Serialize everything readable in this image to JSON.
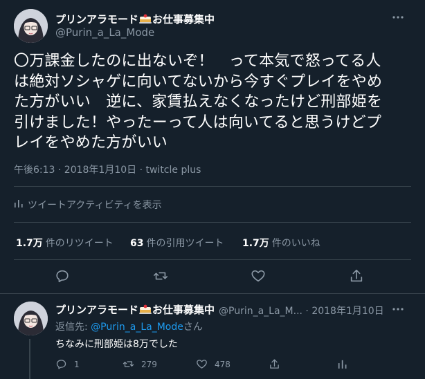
{
  "main_tweet": {
    "display_name": "プリンアラモード",
    "display_name_suffix": "お仕事募集中",
    "handle": "@Purin_a_La_Mode",
    "text_lines": [
      "〇万課金したのに出ないぞ！　って本気で怒ってる人",
      "は絶対ソシャゲに向いてないから今すぐプレイをやめ",
      "た方がいい　逆に、家賃払えなくなったけど刑部姫を",
      "引けました！やったーって人は向いてると思うけどプ",
      "レイをやめた方がいい"
    ],
    "timestamp": "午後6:13 · 2018年1月10日 · twitcle plus",
    "activity_label": "ツイートアクティビティを表示",
    "stats": {
      "retweets_count": "1.7万",
      "retweets_label": "件のリツイート",
      "quotes_count": "63",
      "quotes_label": "件の引用ツイート",
      "likes_count": "1.7万",
      "likes_label": "件のいいね"
    }
  },
  "reply_tweet": {
    "display_name": "プリンアラモード",
    "display_name_suffix": "お仕事募集中",
    "handle_date": "@Purin_a_La_M... · 2018年1月10日",
    "replying_prefix": "返信先: ",
    "replying_to": "@Purin_a_La_Mode",
    "replying_suffix": "さん",
    "text": "ちなみに刑部姫は8万でした",
    "reply_count": "1",
    "retweet_count": "279",
    "like_count": "478"
  },
  "colors": {
    "background": "#15202b",
    "divider": "#38444d",
    "secondary_text": "#8b98a5",
    "link": "#1d9bf0"
  }
}
